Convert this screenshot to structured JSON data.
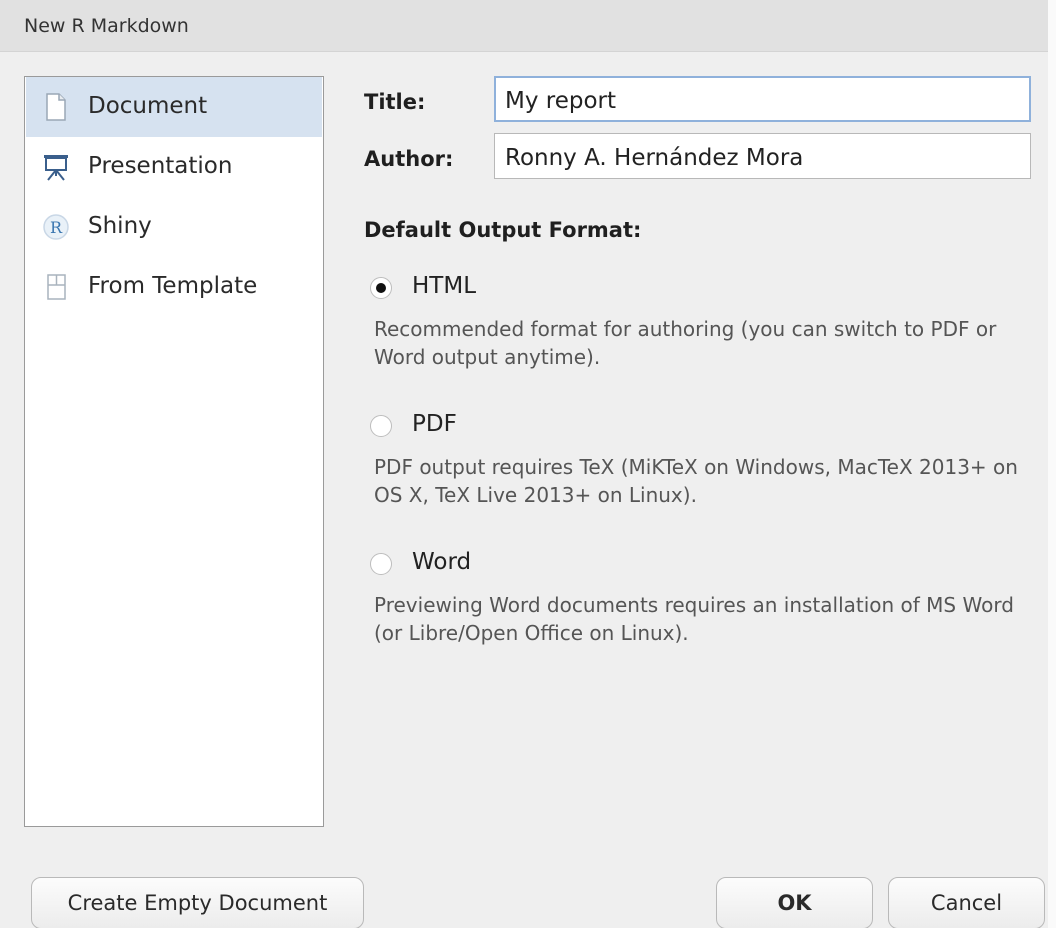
{
  "window": {
    "title": "New R Markdown"
  },
  "sidebar": {
    "items": [
      {
        "label": "Document",
        "icon": "document-icon",
        "selected": true
      },
      {
        "label": "Presentation",
        "icon": "presentation-icon",
        "selected": false
      },
      {
        "label": "Shiny",
        "icon": "shiny-r-icon",
        "selected": false
      },
      {
        "label": "From Template",
        "icon": "template-icon",
        "selected": false
      }
    ]
  },
  "form": {
    "title_label": "Title:",
    "title_value": "My report",
    "author_label": "Author:",
    "author_value": "Ronny A. Hernández Mora",
    "output_section_title": "Default Output Format:",
    "formats": [
      {
        "label": "HTML",
        "checked": true,
        "description": "Recommended format for authoring (you can switch to PDF or Word output anytime)."
      },
      {
        "label": "PDF",
        "checked": false,
        "description": "PDF output requires TeX (MiKTeX on Windows, MacTeX 2013+ on OS X, TeX Live 2013+ on Linux)."
      },
      {
        "label": "Word",
        "checked": false,
        "description": "Previewing Word documents requires an installation of MS Word (or Libre/Open Office on Linux)."
      }
    ]
  },
  "buttons": {
    "create_empty": "Create Empty Document",
    "ok": "OK",
    "cancel": "Cancel"
  },
  "colors": {
    "selection": "#d6e2f0",
    "focus_border": "#8fb1db",
    "dialog_bg": "#efefef"
  }
}
